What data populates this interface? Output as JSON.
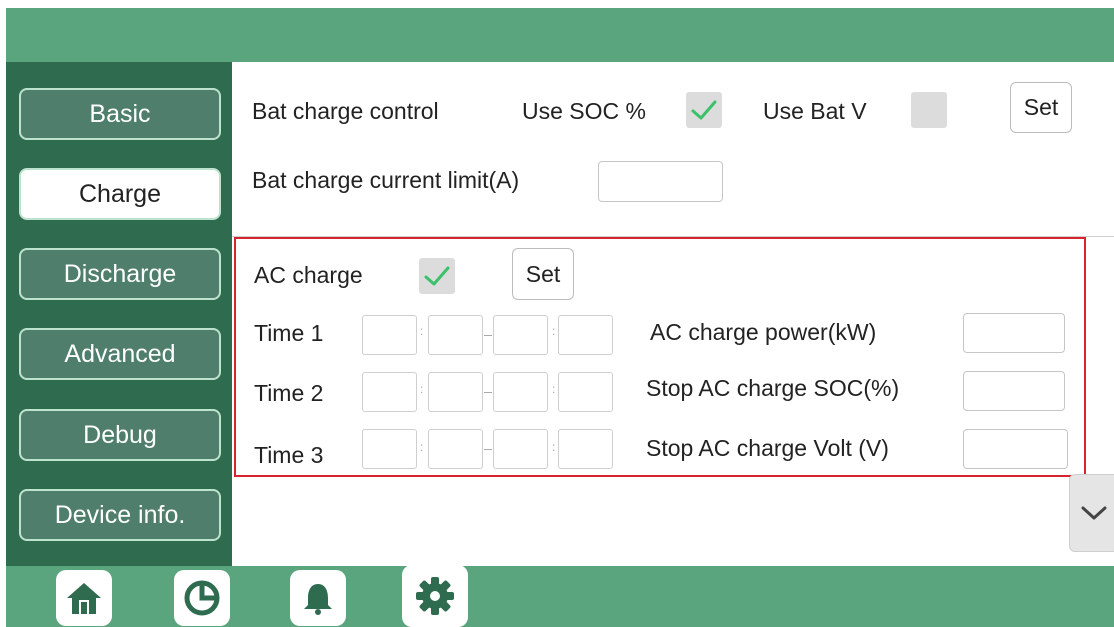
{
  "sidebar": {
    "items": [
      {
        "label": "Basic"
      },
      {
        "label": "Charge"
      },
      {
        "label": "Discharge"
      },
      {
        "label": "Advanced"
      },
      {
        "label": "Debug"
      },
      {
        "label": "Device info."
      }
    ],
    "active": "Charge"
  },
  "charge": {
    "bat_charge_control_label": "Bat charge control",
    "use_soc_label": "Use SOC %",
    "use_soc_checked": true,
    "use_bat_v_label": "Use Bat V",
    "use_bat_v_checked": false,
    "set_label": "Set",
    "current_limit_label": "Bat charge current limit(A)",
    "current_limit_value": ""
  },
  "ac": {
    "ac_charge_label": "AC charge",
    "ac_charge_checked": true,
    "set_label": "Set",
    "times": [
      {
        "label": "Time  1",
        "values": [
          "",
          "",
          "",
          ""
        ]
      },
      {
        "label": "Time  2",
        "values": [
          "",
          "",
          "",
          ""
        ]
      },
      {
        "label": "Time  3",
        "values": [
          "",
          "",
          "",
          ""
        ]
      }
    ],
    "power_label": "AC charge power(kW)",
    "power_value": "",
    "stop_soc_label": "Stop AC charge SOC(%)",
    "stop_soc_value": "",
    "stop_volt_label": "Stop AC charge Volt (V)",
    "stop_volt_value": ""
  },
  "colors": {
    "topbar": "#5aa57e",
    "sidebar": "#2f6b4f",
    "highlight": "#d6262d",
    "check": "#3cc06a"
  },
  "icons": [
    "home-icon",
    "pie-chart-icon",
    "bell-icon",
    "gear-icon",
    "check-icon",
    "chevron-down-icon"
  ]
}
